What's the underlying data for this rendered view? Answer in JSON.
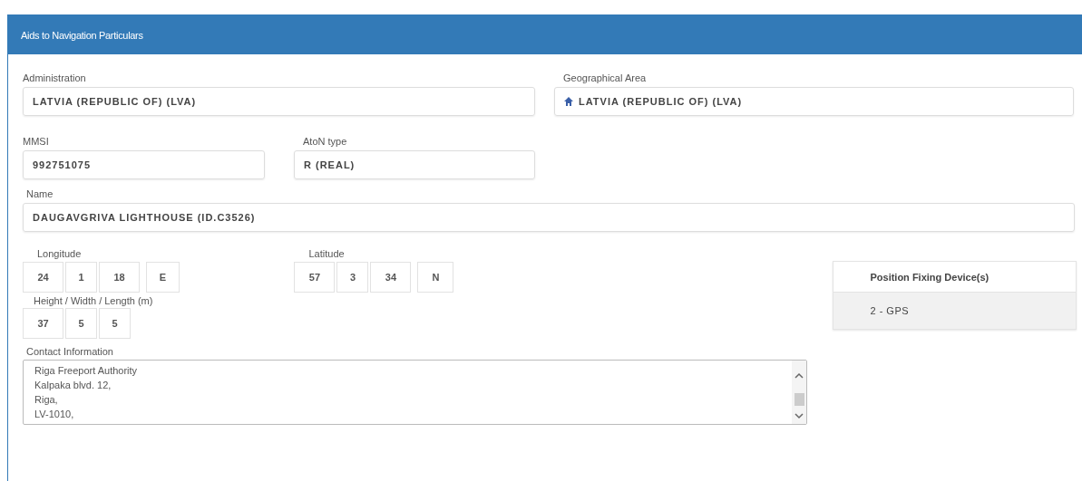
{
  "panel": {
    "title": "Aids to Navigation Particulars"
  },
  "administration": {
    "label": "Administration",
    "value": "LATVIA (REPUBLIC OF) (LVA)"
  },
  "geographical_area": {
    "label": "Geographical Area",
    "value": "LATVIA (REPUBLIC OF) (LVA)"
  },
  "mmsi": {
    "label": "MMSI",
    "value": "992751075"
  },
  "aton_type": {
    "label": "AtoN type",
    "value": "R (REAL)"
  },
  "name": {
    "label": "Name",
    "value": "DAUGAVGRIVA LIGHTHOUSE (ID.C3526)"
  },
  "longitude": {
    "label": "Longitude",
    "parts": [
      "24",
      "1",
      "18",
      "E"
    ]
  },
  "latitude": {
    "label": "Latitude",
    "parts": [
      "57",
      "3",
      "34",
      "N"
    ]
  },
  "dimensions": {
    "label": "Height / Width / Length (m)",
    "parts": [
      "37",
      "5",
      "5"
    ]
  },
  "contact": {
    "label": "Contact Information",
    "lines": [
      "Riga Freeport Authority",
      "Kalpaka blvd. 12,",
      "Riga,",
      "LV-1010,"
    ]
  },
  "position_fixing": {
    "header": "Position Fixing Device(s)",
    "rows": [
      "2 - GPS"
    ]
  }
}
